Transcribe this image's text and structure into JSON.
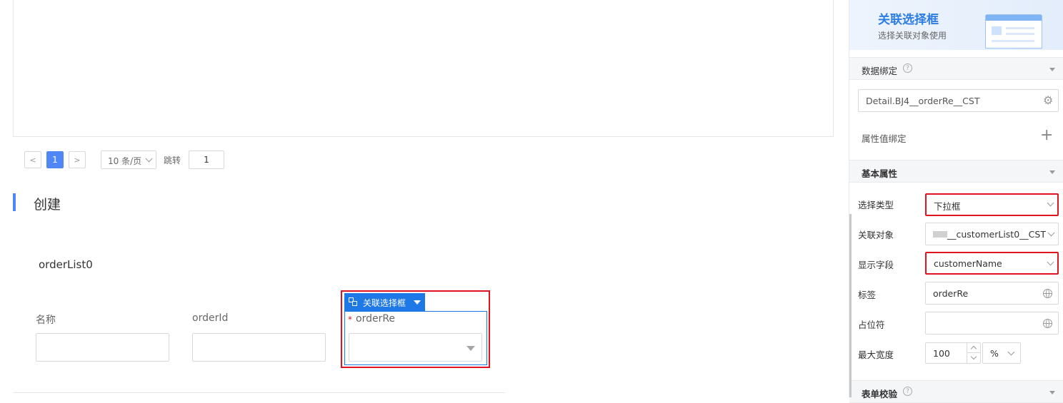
{
  "pagination": {
    "prev": "<",
    "current_page": "1",
    "next": ">",
    "page_size": "10 条/页",
    "jump_label": "跳转",
    "jump_value": "1"
  },
  "section": {
    "title": "创建",
    "form_name": "orderList0",
    "fields": [
      {
        "label": "名称"
      },
      {
        "label": "orderId"
      }
    ],
    "selected_widget": {
      "badge": "关联选择框",
      "required_mark": "*",
      "label": "orderRe"
    }
  },
  "panel": {
    "banner": {
      "title": "关联选择框",
      "subtitle": "选择关联对象使用"
    },
    "data_binding": {
      "title": "数据绑定",
      "help": "?",
      "value": "Detail.BJ4__orderRe__CST",
      "property_binding": "属性值绑定"
    },
    "basic": {
      "title": "基本属性",
      "select_type_label": "选择类型",
      "select_type_value": "下拉框",
      "related_object_label": "关联对象",
      "related_object_value": "__customerList0__CST",
      "display_field_label": "显示字段",
      "display_field_value": "customerName",
      "tag_label": "标签",
      "tag_value": "orderRe",
      "placeholder_label": "占位符",
      "placeholder_value": "",
      "max_width_label": "最大宽度",
      "max_width_value": "100",
      "max_width_unit": "%"
    },
    "validation": {
      "title": "表单校验",
      "help": "?"
    }
  },
  "colors": {
    "accent": "#4f88f6",
    "highlight": "#e0141e",
    "widget_blue": "#1e78e6"
  }
}
